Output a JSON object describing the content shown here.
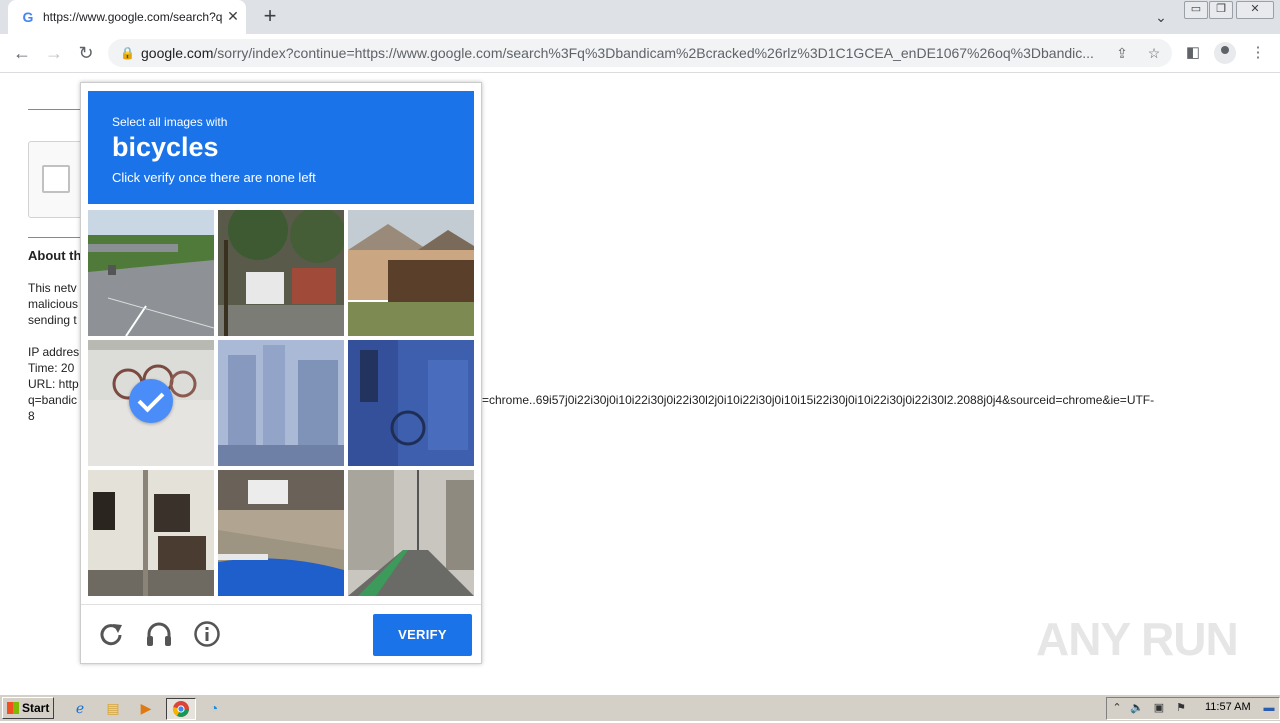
{
  "browser": {
    "tab_title": "https://www.google.com/search?q=",
    "tab_favicon": "G",
    "url_host": "google.com",
    "url_rest": "/sorry/index?continue=https://www.google.com/search%3Fq%3Dbandicam%2Bcracked%26rlz%3D1C1GCEA_enDE1067%26oq%3Dbandic..."
  },
  "page": {
    "about_heading": "About th",
    "body_lines": [
      "This netv",
      "malicious",
      "sending t"
    ],
    "ip_line": "IP addres",
    "time_line": "Time: 20",
    "url_line": "URL: http",
    "url_cont_left": "q=bandic",
    "url_cont_right": "=chrome..69i57j0i22i30j0i10i22i30j0i22i30l2j0i10i22i30j0i10i15i22i30j0i10i22i30j0i22i30l2.2088j0j4&sourceid=chrome&ie=UTF-",
    "url_last": "8"
  },
  "captcha": {
    "prompt_small": "Select all images with",
    "target": "bicycles",
    "instruction": "Click verify once there are none left",
    "verify_label": "VERIFY",
    "tiles": [
      {
        "name": "highway-road",
        "selected": false
      },
      {
        "name": "trucks-street",
        "selected": false
      },
      {
        "name": "houses-fence",
        "selected": false
      },
      {
        "name": "parked-bicycles",
        "selected": true
      },
      {
        "name": "city-buildings",
        "selected": false
      },
      {
        "name": "person-bicycle-wall",
        "selected": false
      },
      {
        "name": "house-facade",
        "selected": false
      },
      {
        "name": "car-garage",
        "selected": false
      },
      {
        "name": "narrow-street",
        "selected": false
      }
    ]
  },
  "watermark": "ANY RUN",
  "taskbar": {
    "start_label": "Start",
    "clock": "11:57 AM"
  },
  "icons": {
    "reload": "reload-icon",
    "audio": "headphones-icon",
    "info": "info-icon"
  }
}
